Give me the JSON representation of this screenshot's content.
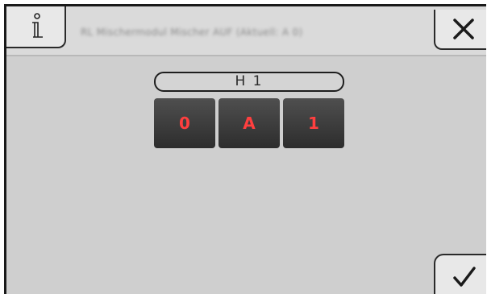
{
  "header": {
    "title": "RL Mischermodul Mischer AUF (Aktuell: A 0)",
    "info_icon": "info-icon",
    "close_icon": "close-icon"
  },
  "channel": {
    "label": "H 1"
  },
  "mode_buttons": [
    {
      "label": "0"
    },
    {
      "label": "A"
    },
    {
      "label": "1"
    }
  ],
  "footer": {
    "confirm_icon": "checkmark-icon"
  },
  "colors": {
    "screen_background": "#cfcfcf",
    "button_dark": "#3a3a3a",
    "accent_red": "#ff3f3f"
  }
}
